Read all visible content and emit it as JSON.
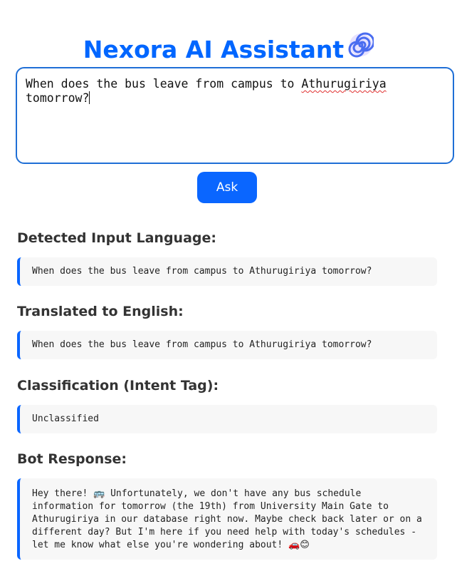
{
  "header": {
    "title": "Nexora AI Assistant",
    "icon": "spiral-icon"
  },
  "query": {
    "text_before": "When does the bus leave from campus to ",
    "misspelled_word": "Athurugiriya",
    "text_after": "\ntomorrow?"
  },
  "actions": {
    "ask_label": "Ask"
  },
  "sections": {
    "detected_language": {
      "heading": "Detected Input Language:",
      "value": "When does the bus leave from campus to Athurugiriya tomorrow?"
    },
    "translated": {
      "heading": "Translated to English:",
      "value": "When does the bus leave from campus to Athurugiriya tomorrow?"
    },
    "classification": {
      "heading": "Classification (Intent Tag):",
      "value": "Unclassified"
    },
    "bot_response": {
      "heading": "Bot Response:",
      "text_part1": "Hey there! ",
      "emoji1": "🚌",
      "text_part2": " Unfortunately, we don't have any bus schedule information for tomorrow (the 19th) from University Main Gate to Athurugiriya in our database right now. Maybe check back later or on a different day? But I'm here if you need help with today's schedules - let me know what else you're wondering about! ",
      "emoji2": "🚗",
      "emoji3": "😊"
    }
  },
  "colors": {
    "accent": "#0a66ff",
    "title": "#0066ff",
    "input_border": "#1f6fd6",
    "result_background": "#f7f7f7",
    "heading_text": "#333333"
  }
}
